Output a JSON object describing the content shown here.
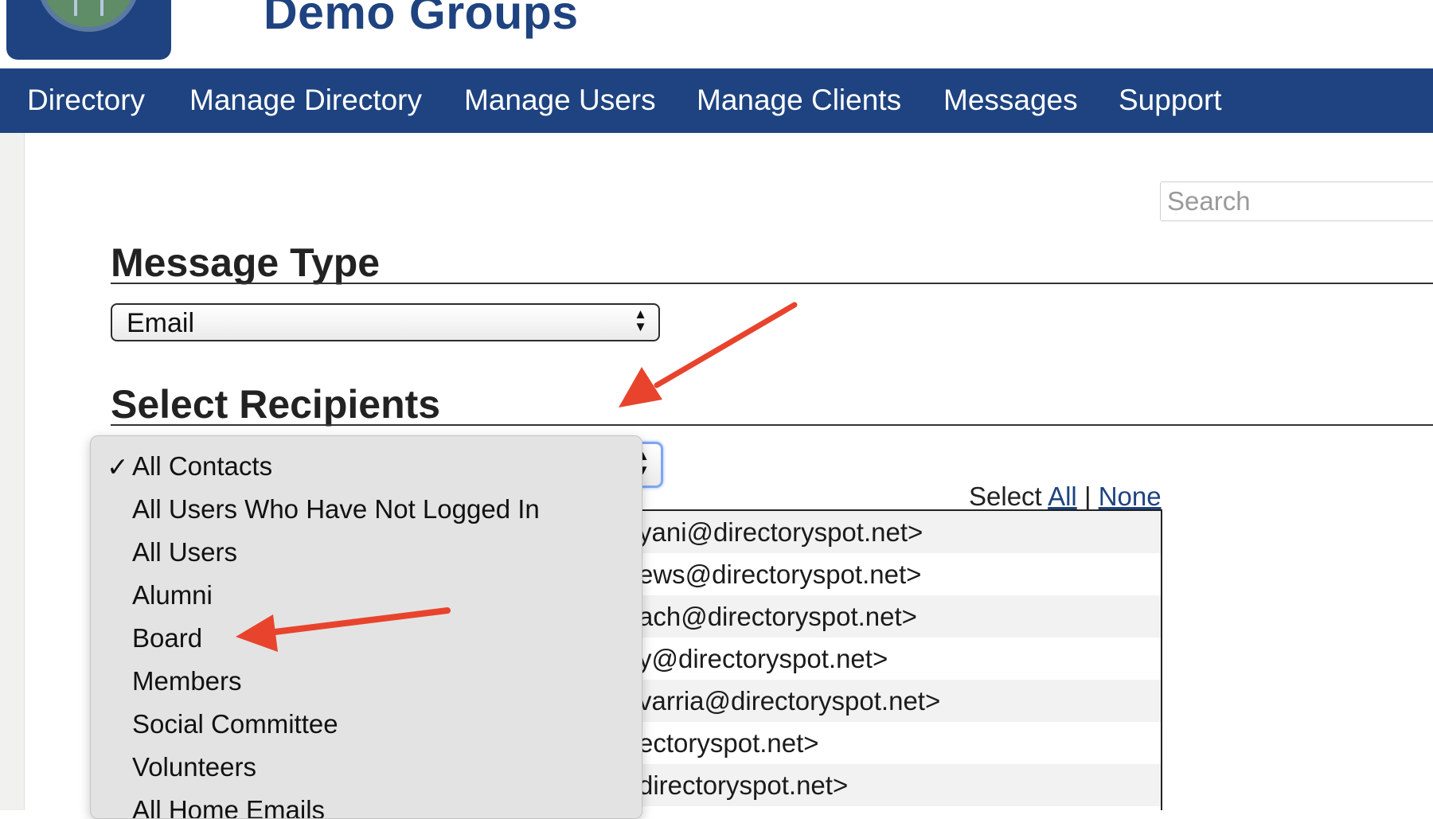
{
  "site": {
    "title": "Demo Groups"
  },
  "nav": {
    "items": [
      {
        "label": "Directory"
      },
      {
        "label": "Manage Directory"
      },
      {
        "label": "Manage Users"
      },
      {
        "label": "Manage Clients"
      },
      {
        "label": "Messages"
      },
      {
        "label": "Support"
      }
    ]
  },
  "search": {
    "placeholder": "Search"
  },
  "message_type": {
    "heading": "Message Type",
    "selected": "Email"
  },
  "recipients": {
    "heading": "Select Recipients",
    "select_prefix": "Select",
    "select_all": "All",
    "separator": "|",
    "select_none": "None",
    "dropdown": {
      "selected_index": 0,
      "check_glyph": "✓",
      "options": [
        "All Contacts",
        "All Users Who Have Not Logged In",
        "All Users",
        "Alumni",
        "Board",
        "Members",
        "Social Committee",
        "Volunteers",
        "All Home Emails"
      ]
    },
    "contacts": [
      "yani@directoryspot.net>",
      "ews@directoryspot.net>",
      "ach@directoryspot.net>",
      "y@directoryspot.net>",
      "varria@directoryspot.net>",
      "ectoryspot.net>",
      "directoryspot.net>"
    ]
  },
  "colors": {
    "brand_blue": "#1e4380",
    "annotation_red": "#e8442d"
  }
}
